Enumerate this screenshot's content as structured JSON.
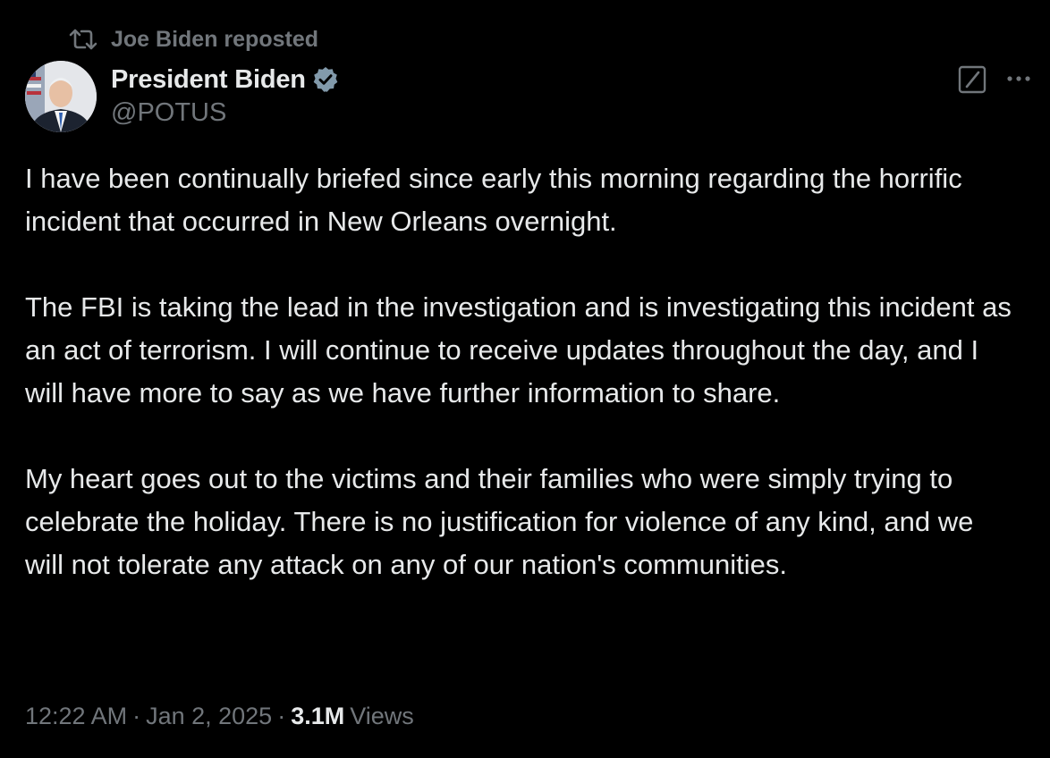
{
  "social_context": {
    "text": "Joe Biden reposted",
    "icon": "repost-icon"
  },
  "author": {
    "display_name": "President Biden",
    "handle": "@POTUS",
    "verified_icon": "verified-badge-icon",
    "verified_color": "#829aab"
  },
  "actions": {
    "grok_icon": "grok-icon",
    "more_icon": "more-options-icon"
  },
  "post": {
    "paragraphs": [
      "I have been continually briefed since early this morning regarding the horrific incident that occurred in New Orleans overnight.",
      "The FBI is taking the lead in the investigation and is investigating this incident as an act of terrorism. I will continue to receive updates throughout the day, and I will have more to say as we have further information to share.",
      "My heart goes out to the victims and their families who were simply trying to celebrate the holiday. There is no justification for violence of any kind, and we will not tolerate any attack on any of our nation's communities."
    ]
  },
  "meta": {
    "time": "12:22 AM",
    "separator": "·",
    "date": "Jan 2, 2025",
    "views_count": "3.1M",
    "views_label": "Views"
  },
  "colors": {
    "background": "#000000",
    "primary_text": "#e7e9ea",
    "secondary_text": "#71767b"
  }
}
